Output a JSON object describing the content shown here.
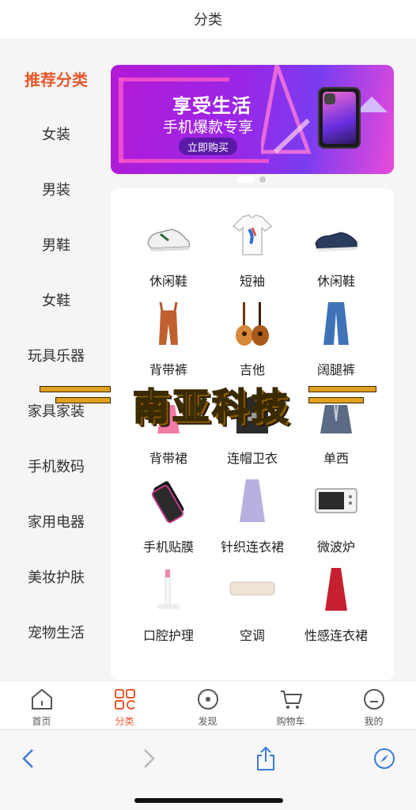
{
  "header": {
    "title": "分类"
  },
  "sidebar": {
    "items": [
      {
        "label": "推荐分类",
        "active": true
      },
      {
        "label": "女装"
      },
      {
        "label": "男装"
      },
      {
        "label": "男鞋"
      },
      {
        "label": "女鞋"
      },
      {
        "label": "玩具乐器"
      },
      {
        "label": "家具家装"
      },
      {
        "label": "手机数码"
      },
      {
        "label": "家用电器"
      },
      {
        "label": "美妆护肤"
      },
      {
        "label": "宠物生活"
      }
    ]
  },
  "banner": {
    "headline": "享受生活",
    "subline": "手机爆款专享",
    "button_label": "立即购买",
    "accent": "#b21ad6"
  },
  "products": [
    {
      "name": "休闲鞋",
      "icon": "sneaker-white-icon"
    },
    {
      "name": "短袖",
      "icon": "tshirt-icon"
    },
    {
      "name": "休闲鞋",
      "icon": "loafer-navy-icon"
    },
    {
      "name": "背带裤",
      "icon": "overalls-icon"
    },
    {
      "name": "吉他",
      "icon": "guitar-icon"
    },
    {
      "name": "阔腿裤",
      "icon": "wide-pants-icon"
    },
    {
      "name": "背带裙",
      "icon": "pinafore-dress-icon"
    },
    {
      "name": "连帽卫衣",
      "icon": "hoodie-icon"
    },
    {
      "name": "单西",
      "icon": "blazer-icon"
    },
    {
      "name": "手机贴膜",
      "icon": "screen-protector-icon"
    },
    {
      "name": "针织连衣裙",
      "icon": "knit-dress-icon"
    },
    {
      "name": "微波炉",
      "icon": "microwave-icon"
    },
    {
      "name": "口腔护理",
      "icon": "toothbrush-icon"
    },
    {
      "name": "空调",
      "icon": "air-conditioner-icon"
    },
    {
      "name": "性感连衣裙",
      "icon": "red-dress-icon"
    }
  ],
  "watermark": {
    "text": "南亚科技"
  },
  "tabbar": {
    "items": [
      {
        "label": "首页",
        "icon": "home-icon"
      },
      {
        "label": "分类",
        "icon": "category-icon",
        "active": true
      },
      {
        "label": "发现",
        "icon": "discover-icon"
      },
      {
        "label": "购物车",
        "icon": "cart-icon"
      },
      {
        "label": "我的",
        "icon": "profile-icon"
      }
    ]
  },
  "colors": {
    "accent": "#e8582b",
    "browser_blue": "#3a7bd5"
  }
}
